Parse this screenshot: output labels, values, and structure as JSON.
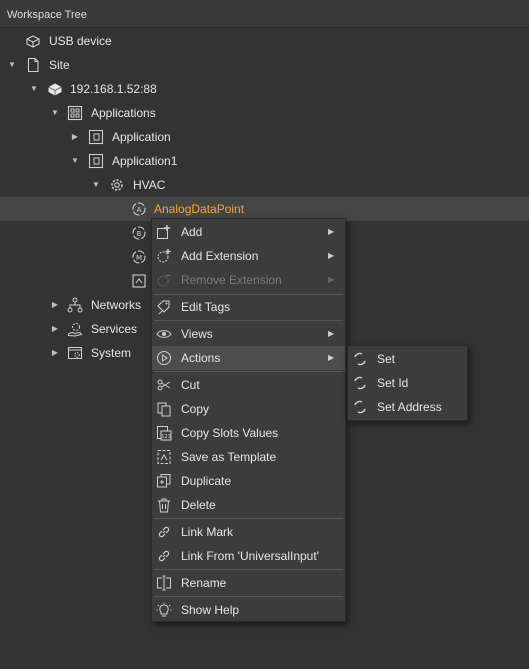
{
  "panel": {
    "title": "Workspace Tree"
  },
  "tree": {
    "usb_device": "USB device",
    "site": "Site",
    "ip": "192.168.1.52:88",
    "applications": "Applications",
    "application": "Application",
    "application1": "Application1",
    "hvac": "HVAC",
    "selected_point": "AnalogDataPoint",
    "networks": "Networks",
    "services": "Services",
    "system": "System"
  },
  "context_menu": {
    "add": "Add",
    "add_extension": "Add Extension",
    "remove_extension": "Remove Extension",
    "edit_tags": "Edit Tags",
    "views": "Views",
    "actions": "Actions",
    "cut": "Cut",
    "copy": "Copy",
    "copy_slots_values": "Copy Slots Values",
    "save_as_template": "Save as Template",
    "duplicate": "Duplicate",
    "delete": "Delete",
    "link_mark": "Link Mark",
    "link_from": "Link From 'UniversalInput'",
    "rename": "Rename",
    "show_help": "Show Help"
  },
  "actions_submenu": {
    "set": "Set",
    "set_id": "Set Id",
    "set_address": "Set Address"
  },
  "colors": {
    "background": "#333333",
    "selected_text": "#f5a623",
    "menu_bg": "#3c3c3c"
  }
}
